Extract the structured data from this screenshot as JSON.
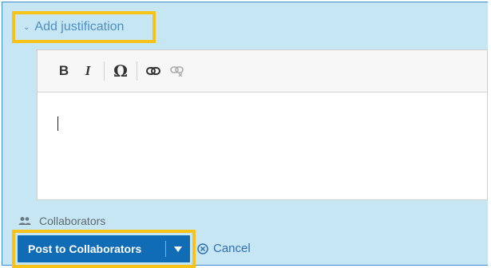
{
  "justification": {
    "toggle_label": "Add justification",
    "icon": "chevron-down-icon"
  },
  "toolbar": {
    "bold_label": "B",
    "italic_label": "I",
    "special_char_label": "Ω",
    "link_icon": "link-icon",
    "unlink_icon": "unlink-icon"
  },
  "collaborators": {
    "label": "Collaborators",
    "icon": "people-icon"
  },
  "actions": {
    "post_label": "Post to Collaborators",
    "cancel_label": "Cancel"
  },
  "colors": {
    "panel_bg": "#c6e6f4",
    "highlight": "#f7c21a",
    "primary_button": "#0f6cb5",
    "link": "#2e6fb2"
  }
}
